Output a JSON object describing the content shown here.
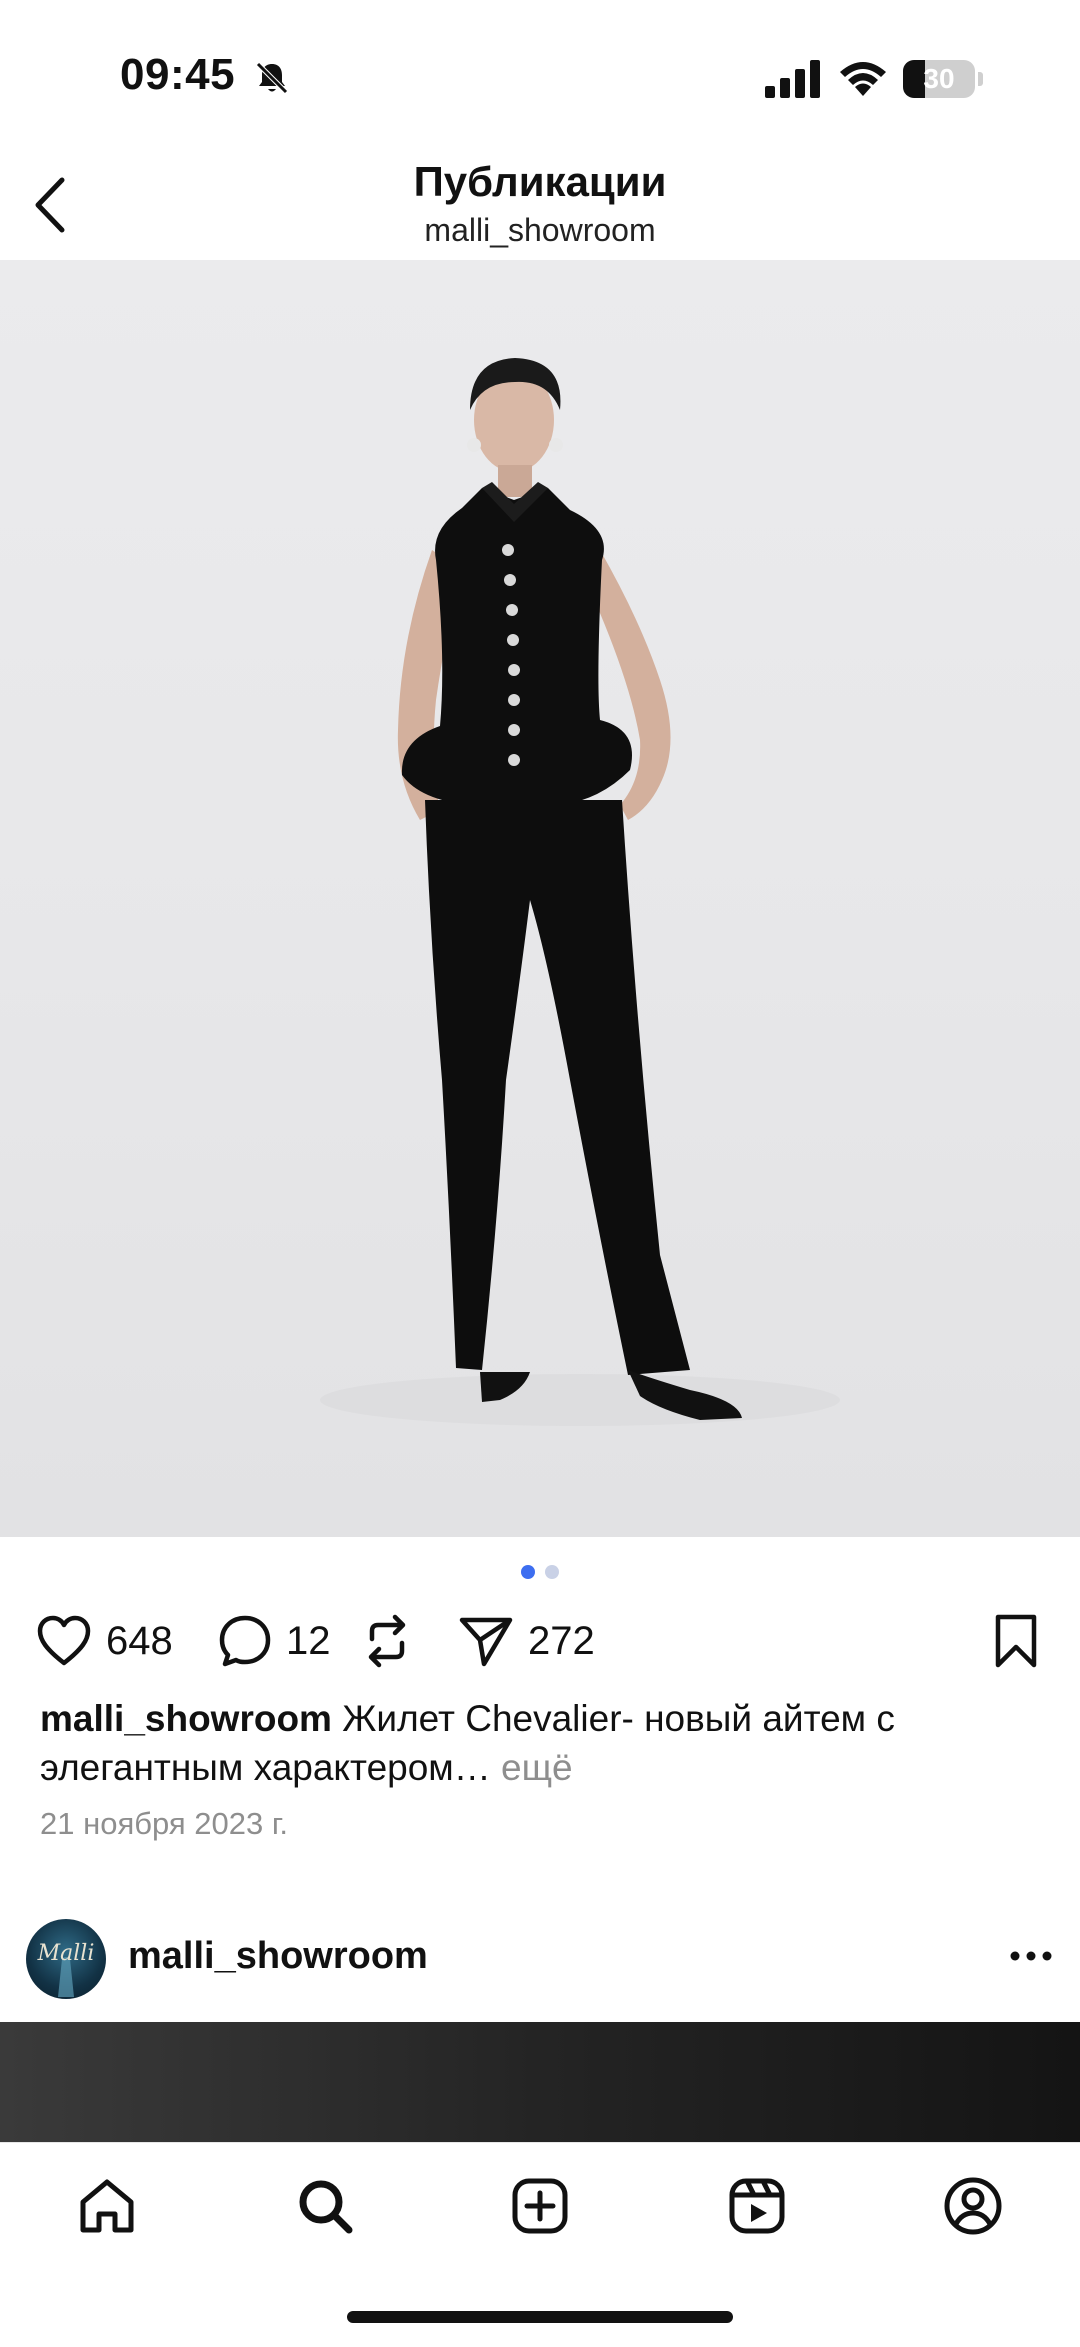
{
  "status_bar": {
    "time": "09:45",
    "battery_level": "30",
    "battery_fraction": 0.3
  },
  "header": {
    "title": "Публикации",
    "subtitle": "malli_showroom"
  },
  "post": {
    "carousel": {
      "count": 2,
      "active_index": 0
    },
    "likes": "648",
    "comments": "12",
    "shares": "272",
    "caption": {
      "username": "malli_showroom",
      "text": "Жилет Chevalier- новый айтем с элегантным характером…",
      "more_label": "ещё"
    },
    "date": "21 ноября 2023 г."
  },
  "next_post": {
    "username": "malli_showroom",
    "avatar_text": "Malli"
  },
  "bottom_nav": {
    "items": [
      "home-icon",
      "search-icon",
      "create-icon",
      "reels-icon",
      "profile-icon"
    ]
  },
  "colors": {
    "accent_dot": "#3d6ef0",
    "inactive_dot": "#c9d1e6",
    "muted_text": "#8e8e8e",
    "text": "#111111"
  }
}
